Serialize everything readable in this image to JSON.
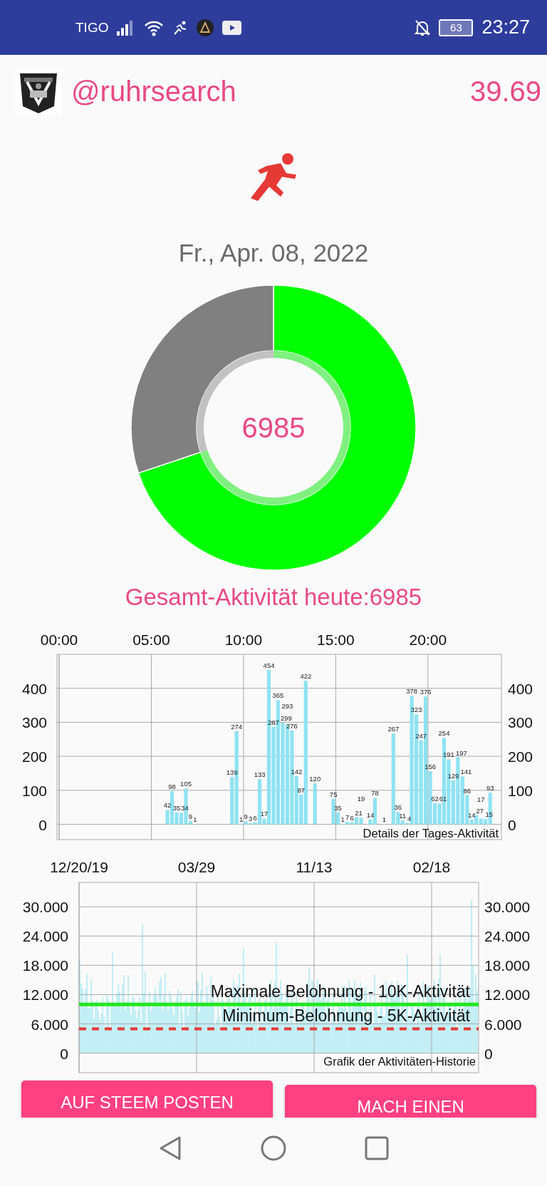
{
  "status_bar": {
    "carrier": "TIGO",
    "battery": "63",
    "time": "23:27"
  },
  "header": {
    "username": "@ruhrsearch",
    "balance": "39.69"
  },
  "date": "Fr., Apr. 08, 2022",
  "progress": {
    "value": "6985"
  },
  "total_label": "Gesamt-Aktivität heute:6985",
  "daily_chart": {
    "left_axis_labels": [
      "400",
      "300",
      "200",
      "100",
      "0"
    ],
    "right_axis_labels": [
      "400",
      "300",
      "200",
      "100",
      "0"
    ],
    "chart_data": {
      "type": "bar",
      "title": "Details der Tages-Aktivität",
      "ylim": [
        -45,
        500
      ],
      "grid": true,
      "categories": [
        "00:00",
        null,
        null,
        null,
        null,
        null,
        null,
        null,
        null,
        null,
        null,
        null,
        null,
        null,
        null,
        null,
        null,
        null,
        null,
        null,
        "05:00",
        null,
        null,
        null,
        null,
        null,
        null,
        null,
        null,
        null,
        null,
        null,
        null,
        null,
        null,
        null,
        null,
        null,
        null,
        null,
        "10:00",
        null,
        null,
        null,
        null,
        null,
        null,
        null,
        null,
        null,
        null,
        null,
        null,
        null,
        null,
        null,
        null,
        null,
        null,
        null,
        "15:00",
        null,
        null,
        null,
        null,
        null,
        null,
        null,
        null,
        null,
        null,
        null,
        null,
        null,
        null,
        null,
        null,
        null,
        null,
        null,
        "20:00",
        null,
        null,
        null,
        null,
        null,
        null,
        null,
        null,
        null,
        null,
        null,
        null,
        null,
        null,
        null
      ],
      "yticks": [
        0,
        100,
        200,
        300,
        400
      ],
      "data_labels": true,
      "values": [
        null,
        null,
        null,
        null,
        null,
        null,
        null,
        null,
        null,
        null,
        null,
        null,
        null,
        null,
        null,
        null,
        null,
        null,
        null,
        null,
        null,
        null,
        null,
        42,
        98,
        35,
        34,
        105,
        9,
        1,
        null,
        null,
        null,
        null,
        null,
        null,
        null,
        139,
        274,
        1,
        9,
        3,
        6,
        133,
        17,
        454,
        287,
        365,
        299,
        293,
        276,
        142,
        87,
        422,
        null,
        120,
        null,
        null,
        null,
        75,
        35,
        1,
        7,
        6,
        21,
        19,
        null,
        14,
        78,
        null,
        1,
        null,
        267,
        36,
        11,
        4,
        378,
        323,
        247,
        376,
        156,
        62,
        61,
        254,
        191,
        129,
        197,
        141,
        86,
        14,
        27,
        17,
        15,
        93,
        null,
        null
      ]
    }
  },
  "history_chart": {
    "right_axis_labels": [
      "30.000",
      "24.000",
      "18.000",
      "12.000",
      "6.000",
      "0"
    ],
    "chart_data": {
      "type": "line",
      "title": "Grafik der Aktivitäten-Historie",
      "ylim": [
        -4,
        35
      ],
      "grid": true,
      "categories": [
        "12/20/19",
        null,
        null,
        null,
        null,
        null,
        null,
        null,
        null,
        null,
        "03/29",
        null,
        null,
        null,
        null,
        null,
        null,
        null,
        null,
        null,
        "11/13",
        null,
        null,
        null,
        null,
        null,
        null,
        null,
        null,
        null,
        "02/18",
        null,
        null,
        null,
        null
      ],
      "yticks": [
        {
          "value": 0,
          "label": "0"
        },
        {
          "value": 6,
          "label": "6.000"
        },
        {
          "value": 12,
          "label": "12.000"
        },
        {
          "value": 18,
          "label": "18.000"
        },
        {
          "value": 24,
          "label": "24.000"
        },
        {
          "value": 30,
          "label": "30.000"
        }
      ],
      "series": [
        {
          "name": "Maximale Belohnung - 10K-Aktivität",
          "color": "#22e622",
          "line_style": "solid",
          "values": [
            10,
            10,
            10,
            10,
            10,
            10,
            10,
            10,
            10,
            10,
            10,
            10,
            10,
            10,
            10,
            10,
            10,
            10,
            10,
            10,
            10,
            10,
            10,
            10,
            10,
            10,
            10,
            10,
            10,
            10,
            10,
            10,
            10,
            10,
            10
          ]
        },
        {
          "name": "Minimum-Belohnung - 5K-Aktivität",
          "color": "#e53935",
          "line_style": "dashed",
          "values": [
            5,
            5,
            5,
            5,
            5,
            5,
            5,
            5,
            5,
            5,
            5,
            5,
            5,
            5,
            5,
            5,
            5,
            5,
            5,
            5,
            5,
            5,
            5,
            5,
            5,
            5,
            5,
            5,
            5,
            5,
            5,
            5,
            5,
            5,
            5
          ]
        }
      ]
    }
  },
  "buttons": [
    "AUF STEEM POSTEN",
    "MACH EINEN"
  ]
}
